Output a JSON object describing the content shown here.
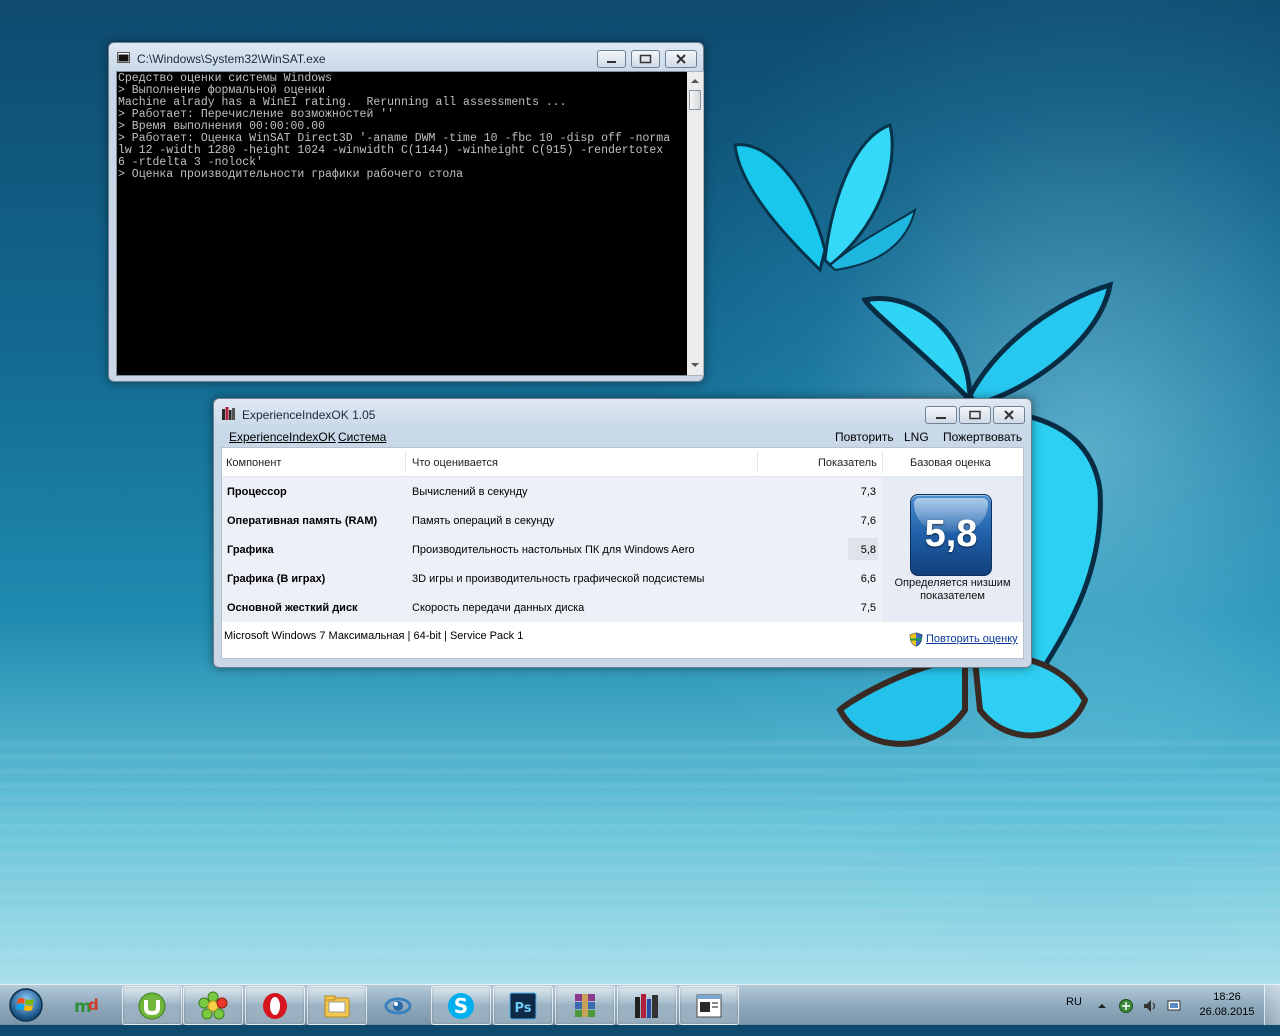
{
  "console": {
    "title": "C:\\Windows\\System32\\WinSAT.exe",
    "lines": [
      "Средство оценки системы Windows",
      "> Выполнение формальной оценки",
      "Machine alrady has a WinEI rating.  Rerunning all assessments ...",
      "> Работает: Перечисление возможностей ''",
      "> Время выполнения 00:00:00.00",
      "> Работает: Оценка WinSAT Direct3D '-aname DWM -time 10 -fbc 10 -disp off -norma",
      "lw 12 -width 1280 -height 1024 -winwidth C(1144) -winheight C(915) -rendertotex",
      "6 -rtdelta 3 -nolock'",
      "> Оценка производительности графики рабочего стола"
    ]
  },
  "exi": {
    "title": "ExperienceIndexOK 1.05",
    "menu_left": [
      "ExperienceIndexOK",
      "Система"
    ],
    "menu_right": [
      "Повторить",
      "LNG",
      "Пожертвовать"
    ],
    "columns": {
      "component": "Компонент",
      "what": "Что оценивается",
      "score": "Показатель",
      "base": "Базовая оценка"
    },
    "rows": [
      {
        "component": "Процессор",
        "what": "Вычислений в секунду",
        "score": "7,3"
      },
      {
        "component": "Оперативная память (RAM)",
        "what": "Память операций в секунду",
        "score": "7,6"
      },
      {
        "component": "Графика",
        "what": "Производительность настольных ПК для Windows Aero",
        "score": "5,8"
      },
      {
        "component": "Графика (В играх)",
        "what": "3D игры и производительность графической подсистемы",
        "score": "6,6"
      },
      {
        "component": "Основной жесткий диск",
        "what": "Скорость передачи данных диска",
        "score": "7,5"
      }
    ],
    "base_score": "5,8",
    "base_caption": "Определяется низшим показателем",
    "os_info": "Microsoft Windows 7 Максимальная | 64-bit | Service Pack 1",
    "rerun_link": "Повторить оценку"
  },
  "taskbar": {
    "apps": [
      "mydefrag-icon",
      "utorrent-icon",
      "icq-icon",
      "opera-icon",
      "explorer-folder-icon",
      "cmd-icon",
      "skype-icon",
      "photoshop-icon",
      "winrar-icon",
      "experienceindexok-icon",
      "winsat-console-icon"
    ],
    "lang": "RU",
    "time": "18:26",
    "date": "26.08.2015"
  }
}
